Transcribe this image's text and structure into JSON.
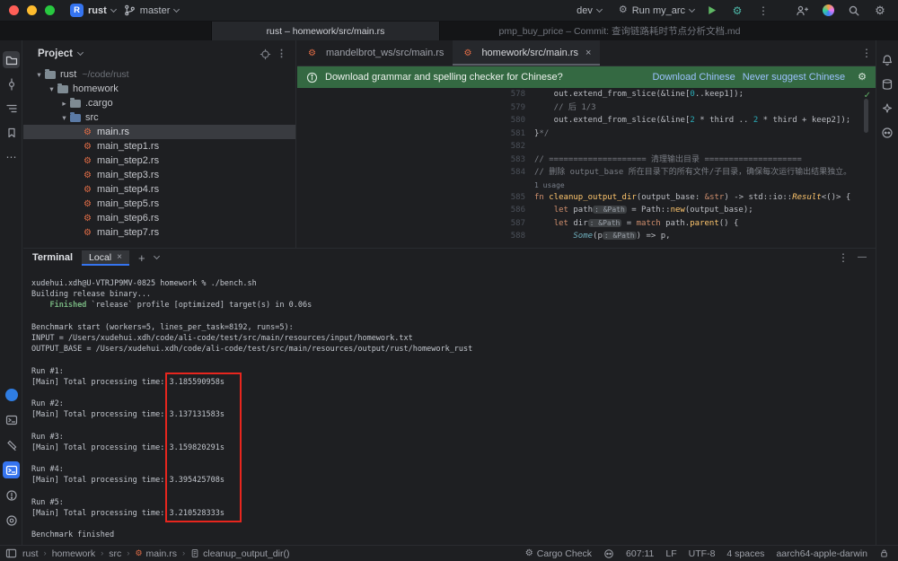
{
  "colors": {
    "accent_blue": "#3574f0",
    "banner_green": "#346942",
    "annotation_red": "#e7261e",
    "run_green": "#5fb865",
    "rust_orange": "#e06c46"
  },
  "icons": {
    "gear": "⚙",
    "rust_file": "⚙",
    "check": "✓",
    "close": "×",
    "plus": "+",
    "play": "▶",
    "more_v": "⋮",
    "more_h": "⋯",
    "minus": "—",
    "chev_exp": "▾",
    "chev_col": "▸",
    "crumb_sep": "›"
  },
  "titlebar": {
    "project_letter": "R",
    "project_name": "rust",
    "branch_name": "master",
    "env_name": "dev",
    "run_config": "Run my_arc"
  },
  "window_tabs": {
    "active_title": "rust – homework/src/main.rs",
    "inactive_title": "pmp_buy_price – Commit: 查询链路耗时节点分析文档.md"
  },
  "project_panel": {
    "title": "Project",
    "root_name": "rust",
    "root_path": "~/code/rust",
    "folder_homework": "homework",
    "folder_cargo": ".cargo",
    "folder_src": "src",
    "files": [
      "main.rs",
      "main_step1.rs",
      "main_step2.rs",
      "main_step3.rs",
      "main_step4.rs",
      "main_step5.rs",
      "main_step6.rs",
      "main_step7.rs"
    ]
  },
  "editor": {
    "tab1": "mandelbrot_ws/src/main.rs",
    "tab2": "homework/src/main.rs",
    "banner": {
      "message": "Download grammar and spelling checker for Chinese?",
      "download_action": "Download Chinese",
      "never_action": "Never suggest Chinese"
    },
    "usage_hint": "1 usage",
    "code": {
      "nums": [
        "578",
        "579",
        "580",
        "581",
        "582",
        "583",
        "584",
        "585",
        "586",
        "587",
        "588"
      ],
      "l578": {
        "a": "    out.extend_from_slice(&line[",
        "b": "0",
        "c": "..keep1]);"
      },
      "l579": "    // 后 1/3",
      "l580": {
        "a": "    out.extend_from_slice(&line[",
        "b": "2",
        "c": " * third .. ",
        "d": "2",
        "e": " * third + keep2]);"
      },
      "l581": {
        "a": "}",
        "b": "*/"
      },
      "l583": "// ==================== 清理输出目录 ====================",
      "l584": "// 删除 output_base 所在目录下的所有文件/子目录，确保每次运行输出结果独立。",
      "l585": {
        "kw": "fn ",
        "name": "cleanup_output_dir",
        "a": "(output_base: ",
        "ty": "&str",
        "b": ") -> std::io::",
        "res": "Result",
        "c": "<()> {"
      },
      "l586": {
        "ind": "    ",
        "kw": "let ",
        "a": "path",
        "hint": ": &Path",
        "b": " = Path::",
        "fn": "new",
        "c": "(output_base);"
      },
      "l587": {
        "ind": "    ",
        "kw": "let ",
        "a": "dir",
        "hint": ": &Path",
        "b": " = ",
        "kw2": "match",
        "c": " path.",
        "fn": "parent",
        "d": "() {"
      },
      "l588": {
        "ind": "        ",
        "en": "Some",
        "a": "(p",
        "hint": ": &Path",
        "b": ") => p,"
      }
    }
  },
  "terminal": {
    "panel_title": "Terminal",
    "tab_label": "Local",
    "prompt_line": "xudehui.xdh@U-VTRJP9MV-0825 homework % ./bench.sh",
    "building_line": "Building release binary...",
    "finished_indent": "    ",
    "finished_word": "Finished",
    "finished_rest": " `release` profile [optimized] target(s) in 0.06s",
    "bench_start_line": "Benchmark start (workers=5, lines_per_task=8192, runs=5):",
    "input_line": "INPUT = /Users/xudehui.xdh/code/ali-code/test/src/main/resources/input/homework.txt",
    "output_line": "OUTPUT_BASE = /Users/xudehui.xdh/code/ali-code/test/src/main/resources/output/rust/homework_rust",
    "runs": [
      {
        "label": "Run #1:",
        "prefix": "[Main] Total processing time: ",
        "time": "3.185590958s"
      },
      {
        "label": "Run #2:",
        "prefix": "[Main] Total processing time: ",
        "time": "3.137131583s"
      },
      {
        "label": "Run #3:",
        "prefix": "[Main] Total processing time: ",
        "time": "3.159820291s"
      },
      {
        "label": "Run #4:",
        "prefix": "[Main] Total processing time: ",
        "time": "3.395425708s"
      },
      {
        "label": "Run #5:",
        "prefix": "[Main] Total processing time: ",
        "time": "3.210528333s"
      }
    ],
    "finished_line": "Benchmark finished"
  },
  "statusbar": {
    "breadcrumbs": [
      "rust",
      "homework",
      "src",
      "main.rs",
      "cleanup_output_dir()"
    ],
    "cargo_check": "Cargo Check",
    "position": "607:11",
    "line_sep": "LF",
    "encoding": "UTF-8",
    "indent": "4 spaces",
    "target": "aarch64-apple-darwin"
  }
}
